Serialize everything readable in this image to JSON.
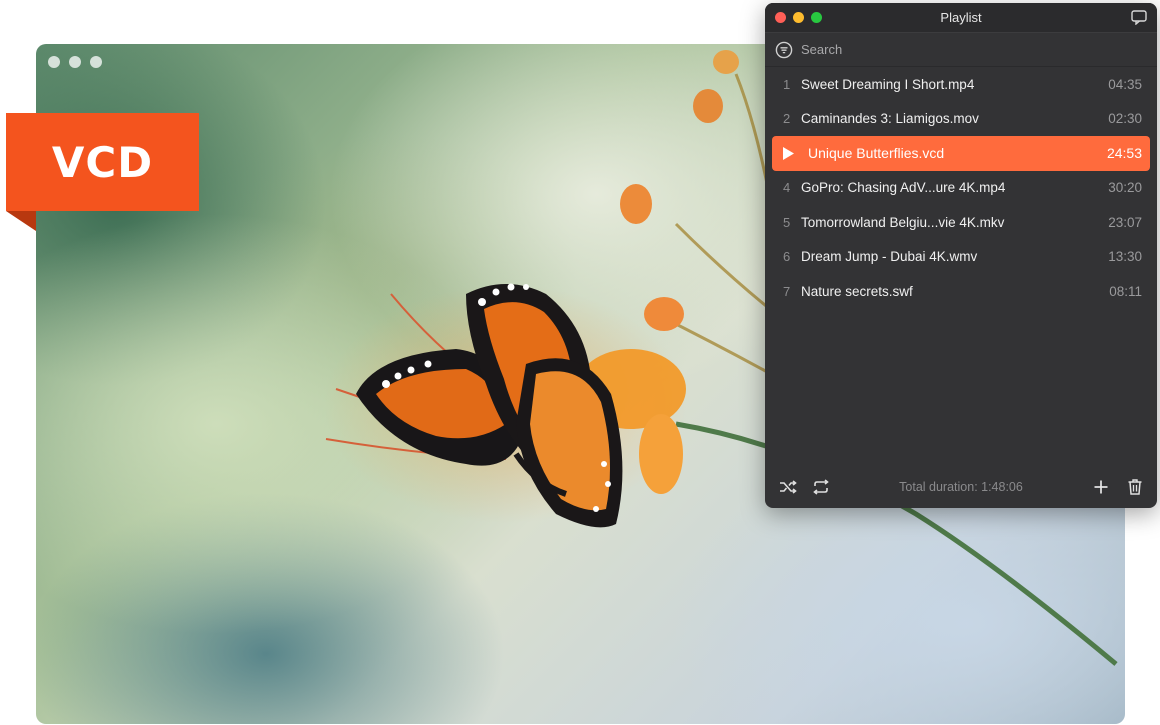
{
  "badge": {
    "label": "VCD"
  },
  "playlist": {
    "title": "Playlist",
    "search_placeholder": "Search",
    "items": [
      {
        "num": "1",
        "name": "Sweet Dreaming I Short.mp4",
        "duration": "04:35"
      },
      {
        "num": "2",
        "name": "Caminandes 3: Liamigos.mov",
        "duration": "02:30"
      },
      {
        "num": "3",
        "name": "Unique Butterflies.vcd",
        "duration": "24:53",
        "playing": true
      },
      {
        "num": "4",
        "name": "GoPro: Chasing AdV...ure 4K.mp4",
        "duration": "30:20"
      },
      {
        "num": "5",
        "name": "Tomorrowland Belgiu...vie 4K.mkv",
        "duration": "23:07"
      },
      {
        "num": "6",
        "name": "Dream Jump - Dubai 4K.wmv",
        "duration": "13:30"
      },
      {
        "num": "7",
        "name": "Nature secrets.swf",
        "duration": "08:11"
      }
    ],
    "total_duration": "Total duration: 1:48:06"
  },
  "colors": {
    "accent": "#ff6b3d",
    "badge": "#f4541e",
    "panel": "#333335"
  },
  "icons": {
    "chat": "chat-bubble-icon",
    "search": "filter-search-icon",
    "play": "play-icon",
    "shuffle": "shuffle-icon",
    "repeat": "repeat-icon",
    "add": "plus-icon",
    "delete": "trash-icon"
  }
}
